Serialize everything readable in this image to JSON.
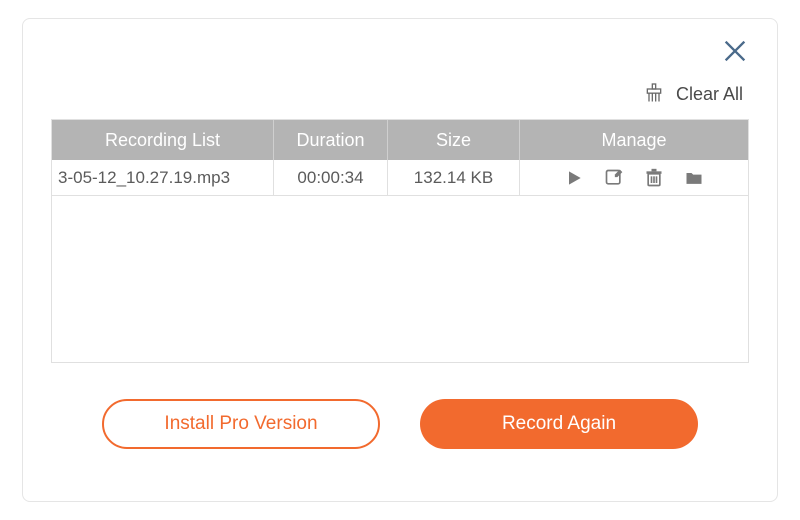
{
  "toolbar": {
    "clear_all_label": "Clear All"
  },
  "table": {
    "headers": {
      "name": "Recording List",
      "duration": "Duration",
      "size": "Size",
      "manage": "Manage"
    },
    "rows": [
      {
        "name": "3-05-12_10.27.19.mp3",
        "duration": "00:00:34",
        "size": "132.14 KB"
      }
    ]
  },
  "buttons": {
    "install_pro": "Install Pro Version",
    "record_again": "Record Again"
  },
  "colors": {
    "accent": "#f26a2e"
  }
}
